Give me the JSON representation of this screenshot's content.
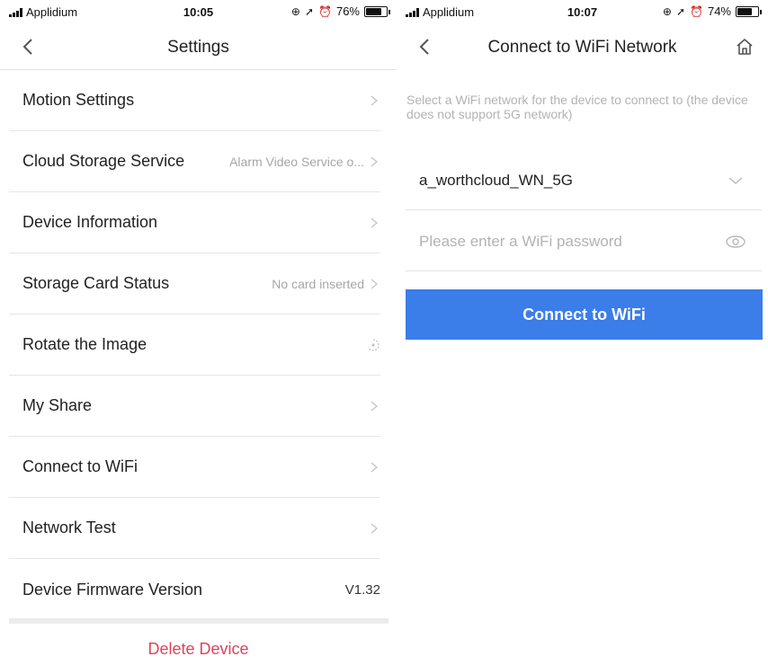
{
  "left": {
    "statusbar": {
      "carrier": "Applidium",
      "time": "10:05",
      "battery_text": "76%",
      "battery_level": 0.76
    },
    "nav": {
      "title": "Settings"
    },
    "rows": [
      {
        "label": "Motion Settings",
        "value": ""
      },
      {
        "label": "Cloud Storage Service",
        "value": "Alarm Video Service o..."
      },
      {
        "label": "Device Information",
        "value": ""
      },
      {
        "label": "Storage Card Status",
        "value": "No card inserted"
      },
      {
        "label": "Rotate the Image",
        "value": ""
      },
      {
        "label": "My Share",
        "value": ""
      },
      {
        "label": "Connect to WiFi",
        "value": ""
      },
      {
        "label": "Network Test",
        "value": ""
      },
      {
        "label": "Device Firmware Version",
        "value": "V1.32"
      }
    ],
    "delete_label": "Delete Device"
  },
  "right": {
    "statusbar": {
      "carrier": "Applidium",
      "time": "10:07",
      "battery_text": "74%",
      "battery_level": 0.74
    },
    "nav": {
      "title": "Connect to WiFi Network"
    },
    "hint": "Select a WiFi network for the device to connect to (the device does not support 5G network)",
    "network": {
      "selected": "a_worthcloud_WN_5G"
    },
    "password": {
      "placeholder": "Please enter a WiFi password",
      "value": ""
    },
    "connect_label": "Connect to WiFi"
  },
  "colors": {
    "accent": "#3b7de9",
    "danger": "#e0435a",
    "muted": "#a6a6a6"
  },
  "icons": [
    "signal-icon",
    "location-icon",
    "alarm-icon",
    "battery-icon",
    "back-icon",
    "home-icon",
    "chevron-right-icon",
    "rotate-icon",
    "chevron-down-icon",
    "eye-icon"
  ]
}
